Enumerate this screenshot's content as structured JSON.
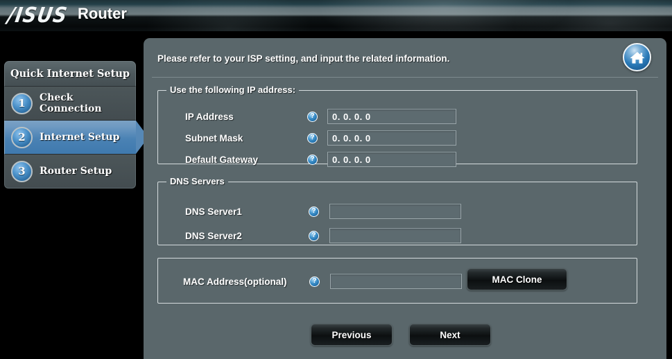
{
  "banner": {
    "logo": "/ISUS",
    "title": "Router",
    "home_icon": "home-icon"
  },
  "sidebar": {
    "header": "Quick Internet Setup",
    "items": [
      {
        "number": "1",
        "label": "Check Connection",
        "active": false
      },
      {
        "number": "2",
        "label": "Internet Setup",
        "active": true
      },
      {
        "number": "3",
        "label": "Router Setup",
        "active": false
      }
    ]
  },
  "main": {
    "instruction": "Please refer to your ISP setting, and input the related information.",
    "ip_section": {
      "legend": "Use the following IP address:",
      "fields": [
        {
          "label": "IP Address",
          "value": "0. 0. 0. 0",
          "help": "?"
        },
        {
          "label": "Subnet Mask",
          "value": "0. 0. 0. 0",
          "help": "?"
        },
        {
          "label": "Default Gateway",
          "value": "0. 0. 0. 0",
          "help": "?"
        }
      ]
    },
    "dns_section": {
      "legend": "DNS Servers",
      "fields": [
        {
          "label": "DNS Server1",
          "value": "",
          "help": "?"
        },
        {
          "label": "DNS Server2",
          "value": "",
          "help": "?"
        }
      ]
    },
    "mac_section": {
      "label": "MAC Address(optional)",
      "value": "",
      "help": "?",
      "clone_button": "MAC Clone"
    },
    "footer": {
      "previous": "Previous",
      "next": "Next"
    }
  },
  "colors": {
    "panel_bg": "#5a676b",
    "accent_blue": "#4a82b4",
    "input_bg": "#5d6b70",
    "border_light": "#d5dcde",
    "button_dark": "#0c0f10"
  }
}
